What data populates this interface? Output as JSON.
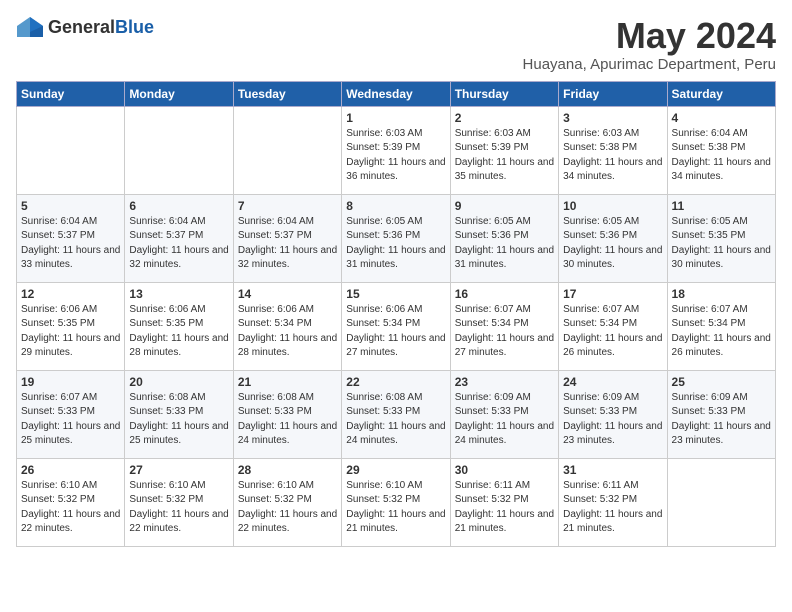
{
  "logo": {
    "text_general": "General",
    "text_blue": "Blue"
  },
  "title": "May 2024",
  "location": "Huayana, Apurimac Department, Peru",
  "weekdays": [
    "Sunday",
    "Monday",
    "Tuesday",
    "Wednesday",
    "Thursday",
    "Friday",
    "Saturday"
  ],
  "weeks": [
    [
      {
        "day": "",
        "sunrise": "",
        "sunset": "",
        "daylight": ""
      },
      {
        "day": "",
        "sunrise": "",
        "sunset": "",
        "daylight": ""
      },
      {
        "day": "",
        "sunrise": "",
        "sunset": "",
        "daylight": ""
      },
      {
        "day": "1",
        "sunrise": "Sunrise: 6:03 AM",
        "sunset": "Sunset: 5:39 PM",
        "daylight": "Daylight: 11 hours and 36 minutes."
      },
      {
        "day": "2",
        "sunrise": "Sunrise: 6:03 AM",
        "sunset": "Sunset: 5:39 PM",
        "daylight": "Daylight: 11 hours and 35 minutes."
      },
      {
        "day": "3",
        "sunrise": "Sunrise: 6:03 AM",
        "sunset": "Sunset: 5:38 PM",
        "daylight": "Daylight: 11 hours and 34 minutes."
      },
      {
        "day": "4",
        "sunrise": "Sunrise: 6:04 AM",
        "sunset": "Sunset: 5:38 PM",
        "daylight": "Daylight: 11 hours and 34 minutes."
      }
    ],
    [
      {
        "day": "5",
        "sunrise": "Sunrise: 6:04 AM",
        "sunset": "Sunset: 5:37 PM",
        "daylight": "Daylight: 11 hours and 33 minutes."
      },
      {
        "day": "6",
        "sunrise": "Sunrise: 6:04 AM",
        "sunset": "Sunset: 5:37 PM",
        "daylight": "Daylight: 11 hours and 32 minutes."
      },
      {
        "day": "7",
        "sunrise": "Sunrise: 6:04 AM",
        "sunset": "Sunset: 5:37 PM",
        "daylight": "Daylight: 11 hours and 32 minutes."
      },
      {
        "day": "8",
        "sunrise": "Sunrise: 6:05 AM",
        "sunset": "Sunset: 5:36 PM",
        "daylight": "Daylight: 11 hours and 31 minutes."
      },
      {
        "day": "9",
        "sunrise": "Sunrise: 6:05 AM",
        "sunset": "Sunset: 5:36 PM",
        "daylight": "Daylight: 11 hours and 31 minutes."
      },
      {
        "day": "10",
        "sunrise": "Sunrise: 6:05 AM",
        "sunset": "Sunset: 5:36 PM",
        "daylight": "Daylight: 11 hours and 30 minutes."
      },
      {
        "day": "11",
        "sunrise": "Sunrise: 6:05 AM",
        "sunset": "Sunset: 5:35 PM",
        "daylight": "Daylight: 11 hours and 30 minutes."
      }
    ],
    [
      {
        "day": "12",
        "sunrise": "Sunrise: 6:06 AM",
        "sunset": "Sunset: 5:35 PM",
        "daylight": "Daylight: 11 hours and 29 minutes."
      },
      {
        "day": "13",
        "sunrise": "Sunrise: 6:06 AM",
        "sunset": "Sunset: 5:35 PM",
        "daylight": "Daylight: 11 hours and 28 minutes."
      },
      {
        "day": "14",
        "sunrise": "Sunrise: 6:06 AM",
        "sunset": "Sunset: 5:34 PM",
        "daylight": "Daylight: 11 hours and 28 minutes."
      },
      {
        "day": "15",
        "sunrise": "Sunrise: 6:06 AM",
        "sunset": "Sunset: 5:34 PM",
        "daylight": "Daylight: 11 hours and 27 minutes."
      },
      {
        "day": "16",
        "sunrise": "Sunrise: 6:07 AM",
        "sunset": "Sunset: 5:34 PM",
        "daylight": "Daylight: 11 hours and 27 minutes."
      },
      {
        "day": "17",
        "sunrise": "Sunrise: 6:07 AM",
        "sunset": "Sunset: 5:34 PM",
        "daylight": "Daylight: 11 hours and 26 minutes."
      },
      {
        "day": "18",
        "sunrise": "Sunrise: 6:07 AM",
        "sunset": "Sunset: 5:34 PM",
        "daylight": "Daylight: 11 hours and 26 minutes."
      }
    ],
    [
      {
        "day": "19",
        "sunrise": "Sunrise: 6:07 AM",
        "sunset": "Sunset: 5:33 PM",
        "daylight": "Daylight: 11 hours and 25 minutes."
      },
      {
        "day": "20",
        "sunrise": "Sunrise: 6:08 AM",
        "sunset": "Sunset: 5:33 PM",
        "daylight": "Daylight: 11 hours and 25 minutes."
      },
      {
        "day": "21",
        "sunrise": "Sunrise: 6:08 AM",
        "sunset": "Sunset: 5:33 PM",
        "daylight": "Daylight: 11 hours and 24 minutes."
      },
      {
        "day": "22",
        "sunrise": "Sunrise: 6:08 AM",
        "sunset": "Sunset: 5:33 PM",
        "daylight": "Daylight: 11 hours and 24 minutes."
      },
      {
        "day": "23",
        "sunrise": "Sunrise: 6:09 AM",
        "sunset": "Sunset: 5:33 PM",
        "daylight": "Daylight: 11 hours and 24 minutes."
      },
      {
        "day": "24",
        "sunrise": "Sunrise: 6:09 AM",
        "sunset": "Sunset: 5:33 PM",
        "daylight": "Daylight: 11 hours and 23 minutes."
      },
      {
        "day": "25",
        "sunrise": "Sunrise: 6:09 AM",
        "sunset": "Sunset: 5:33 PM",
        "daylight": "Daylight: 11 hours and 23 minutes."
      }
    ],
    [
      {
        "day": "26",
        "sunrise": "Sunrise: 6:10 AM",
        "sunset": "Sunset: 5:32 PM",
        "daylight": "Daylight: 11 hours and 22 minutes."
      },
      {
        "day": "27",
        "sunrise": "Sunrise: 6:10 AM",
        "sunset": "Sunset: 5:32 PM",
        "daylight": "Daylight: 11 hours and 22 minutes."
      },
      {
        "day": "28",
        "sunrise": "Sunrise: 6:10 AM",
        "sunset": "Sunset: 5:32 PM",
        "daylight": "Daylight: 11 hours and 22 minutes."
      },
      {
        "day": "29",
        "sunrise": "Sunrise: 6:10 AM",
        "sunset": "Sunset: 5:32 PM",
        "daylight": "Daylight: 11 hours and 21 minutes."
      },
      {
        "day": "30",
        "sunrise": "Sunrise: 6:11 AM",
        "sunset": "Sunset: 5:32 PM",
        "daylight": "Daylight: 11 hours and 21 minutes."
      },
      {
        "day": "31",
        "sunrise": "Sunrise: 6:11 AM",
        "sunset": "Sunset: 5:32 PM",
        "daylight": "Daylight: 11 hours and 21 minutes."
      },
      {
        "day": "",
        "sunrise": "",
        "sunset": "",
        "daylight": ""
      }
    ]
  ]
}
